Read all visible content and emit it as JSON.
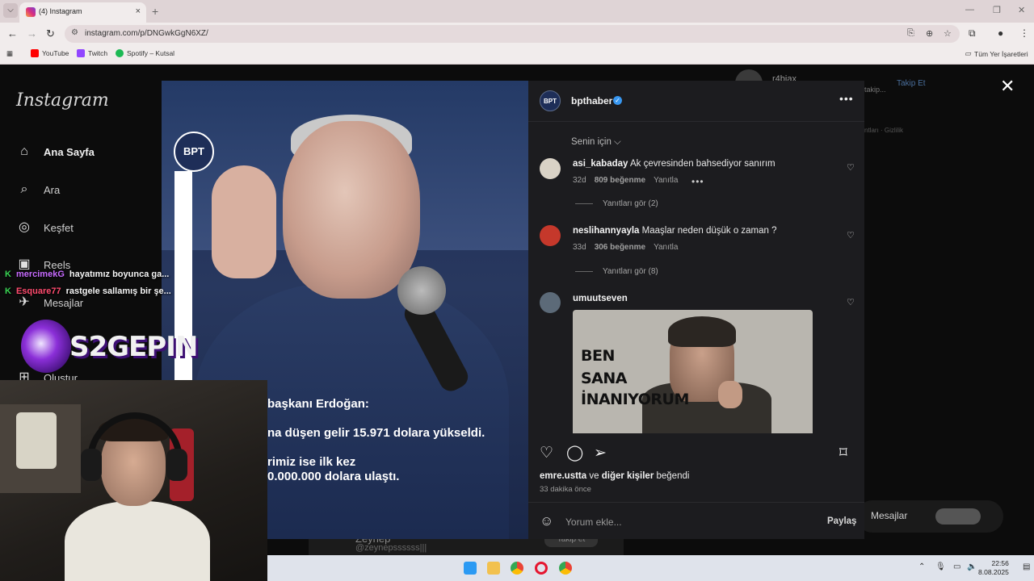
{
  "browser": {
    "tab_title": "(4) Instagram",
    "tab_close": "×",
    "new_tab": "+",
    "url": "instagram.com/p/DNGwkGgN6XZ/",
    "bookmarks": [
      {
        "label": "YouTube",
        "color": "#ff0000"
      },
      {
        "label": "Twitch",
        "color": "#9146ff"
      },
      {
        "label": "Spotify – Kutsal",
        "color": "#1db954"
      }
    ],
    "bookmarks_all": "Tüm Yer İşaretleri"
  },
  "instagram": {
    "logo": "Instagram",
    "nav": [
      {
        "label": "Ana Sayfa",
        "icon": "home-icon"
      },
      {
        "label": "Ara",
        "icon": "search-icon"
      },
      {
        "label": "Keşfet",
        "icon": "compass-icon"
      },
      {
        "label": "Reels",
        "icon": "reels-icon"
      },
      {
        "label": "Mesajlar",
        "icon": "message-icon"
      },
      {
        "label": "Oluştur",
        "icon": "create-icon"
      }
    ],
    "bg_suggest_name": "r4biax",
    "bg_suggest_sub": "takip...",
    "bg_follow": "Takip Et",
    "bg_footer": "ntları · Gizlilik",
    "bg_messages": "Mesajlar",
    "bg_zeynep_name": "Zeynep",
    "bg_zeynep_handle": "@zeynepssssss|||",
    "bg_zeynep_follow": "Takip et"
  },
  "post": {
    "account": "bpthaber",
    "avatar_text": "BPT",
    "verified": "✓",
    "image_logo": "BPT",
    "image_lines": [
      "başkanı Erdoğan:",
      "na düşen gelir 15.971 dolara yükseldi.",
      "rimiz ise ilk kez",
      "0.000.000 dolara ulaştı."
    ],
    "sort_label": "Senin için ⌵",
    "comments": [
      {
        "user": "asi_kabaday",
        "text": "Ak çevresinden bahsediyor sanırım",
        "age": "32d",
        "likes": "809 beğenme",
        "reply": "Yanıtla",
        "replies": "Yanıtları gör (2)",
        "avatar_color": "#d9d2c6"
      },
      {
        "user": "neslihannyayla",
        "text": "Maaşlar neden düşük o zaman ?",
        "age": "33d",
        "likes": "306 beğenme",
        "reply": "Yanıtla",
        "replies": "Yanıtları gör (8)",
        "avatar_color": "#c5382b"
      },
      {
        "user": "umuutseven",
        "text": "",
        "avatar_color": "#5c6a78"
      }
    ],
    "meme_lines": [
      "BEN",
      "SANA",
      "İNANIYORUM"
    ],
    "liked_user": "emre.ustta",
    "liked_and": "ve",
    "liked_others": "diğer kişiler",
    "liked_suffix": "beğendi",
    "ago": "33 dakika önce",
    "comment_placeholder": "Yorum ekle...",
    "share": "Paylaş"
  },
  "overlay": {
    "chat": [
      {
        "user": "mercimekG",
        "text": "hayatımız boyunca ga..."
      },
      {
        "user": "Esquare77",
        "text": "rastgele sallamış bir şe..."
      }
    ],
    "logo_text": "S2GEPIN"
  },
  "taskbar": {
    "time": "22:56",
    "date": "8.08.2025"
  }
}
